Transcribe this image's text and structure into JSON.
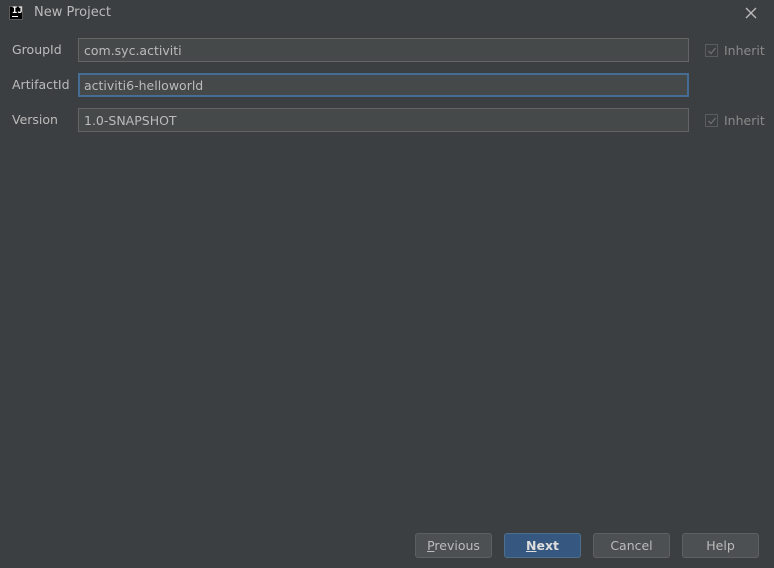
{
  "window": {
    "title": "New Project",
    "app_icon_text": "IJ"
  },
  "form": {
    "group_id": {
      "label": "GroupId",
      "value": "com.syc.activiti",
      "inherit_label": "Inherit",
      "inherit_checked": true
    },
    "artifact_id": {
      "label": "ArtifactId",
      "value": "activiti6-helloworld"
    },
    "version": {
      "label": "Version",
      "value": "1.0-SNAPSHOT",
      "inherit_label": "Inherit",
      "inherit_checked": true
    }
  },
  "buttons": {
    "previous_mnemonic": "P",
    "previous_rest": "revious",
    "next_mnemonic": "N",
    "next_rest": "ext",
    "cancel": "Cancel",
    "help": "Help"
  },
  "colors": {
    "background": "#3c3f41",
    "field_background": "#45494a",
    "focus_border": "#466d94",
    "default_button": "#365880"
  }
}
